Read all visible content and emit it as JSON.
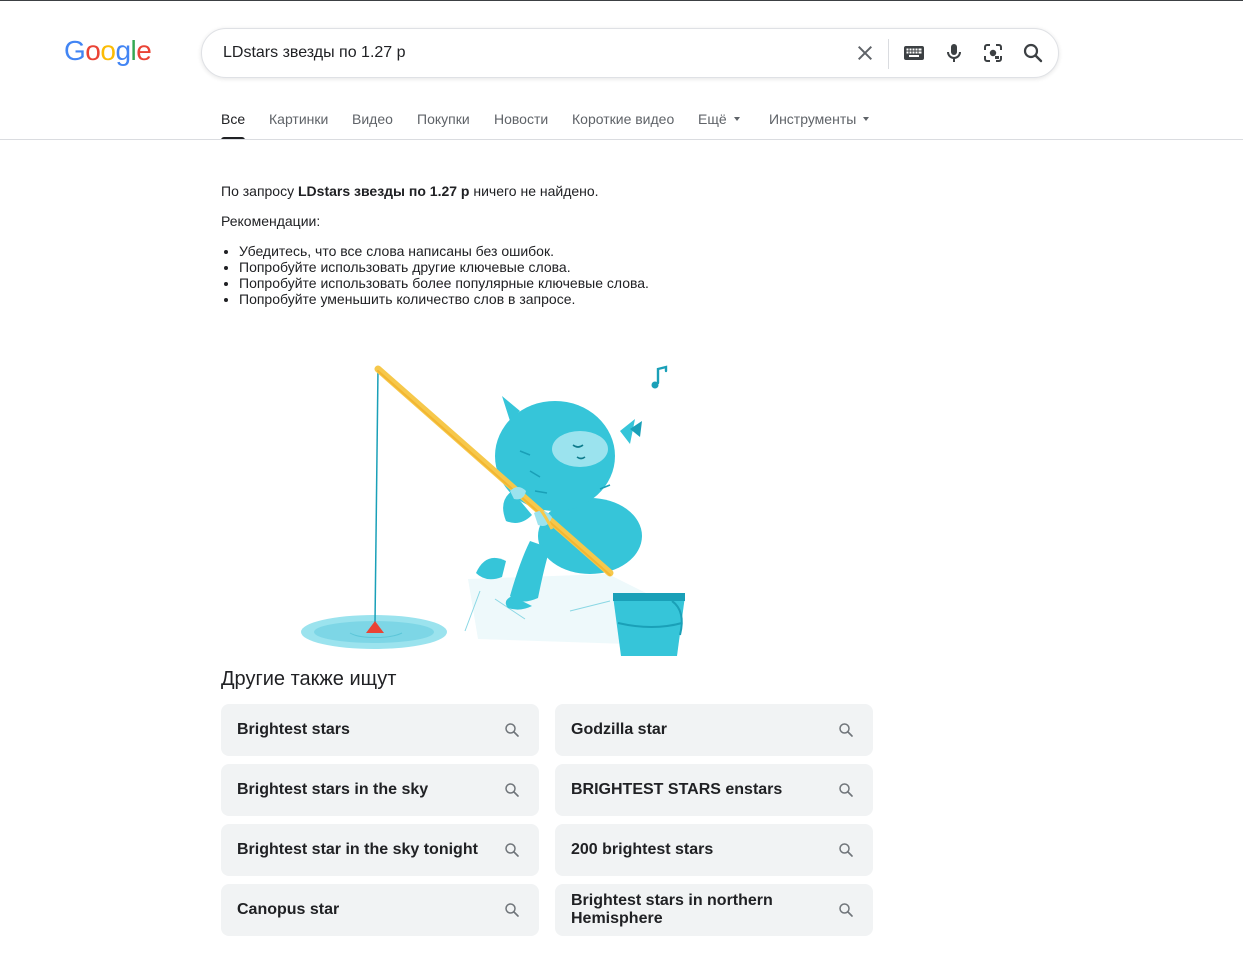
{
  "header": {
    "logo_text": "Google",
    "search_query": "LDstars звезды по 1.27 р",
    "icons": [
      "clear-icon",
      "keyboard-icon",
      "microphone-icon",
      "lens-icon",
      "search-icon"
    ]
  },
  "tabs": [
    {
      "label": "Все",
      "active": true
    },
    {
      "label": "Картинки"
    },
    {
      "label": "Видео"
    },
    {
      "label": "Покупки"
    },
    {
      "label": "Новости"
    },
    {
      "label": "Короткие видео"
    },
    {
      "label": "Ещё"
    },
    {
      "label": "Инструменты"
    }
  ],
  "no_results": {
    "prefix": "По запросу ",
    "query": "LDstars звезды по 1.27 р",
    "suffix": " ничего не найдено.",
    "recommendations_title": "Рекомендации:",
    "tips": [
      "Убедитесь, что все слова написаны без ошибок.",
      "Попробуйте использовать другие ключевые слова.",
      "Попробуйте использовать более популярные ключевые слова.",
      "Попробуйте уменьшить количество слов в запросе."
    ]
  },
  "also_searched": {
    "title": "Другие также ищут",
    "items": [
      "Brightest stars",
      "Godzilla star",
      "Brightest stars in the sky",
      "BRIGHTEST STARS enstars",
      "Brightest star in the sky tonight",
      "200 brightest stars",
      "Canopus star",
      "Brightest stars in northern Hemisphere"
    ]
  },
  "colors": {
    "google_blue": "#4285F4",
    "google_red": "#EA4335",
    "google_yellow": "#FBBC05",
    "google_green": "#34A853",
    "monster": "#36c5d9",
    "chip_bg": "#f1f3f4"
  }
}
